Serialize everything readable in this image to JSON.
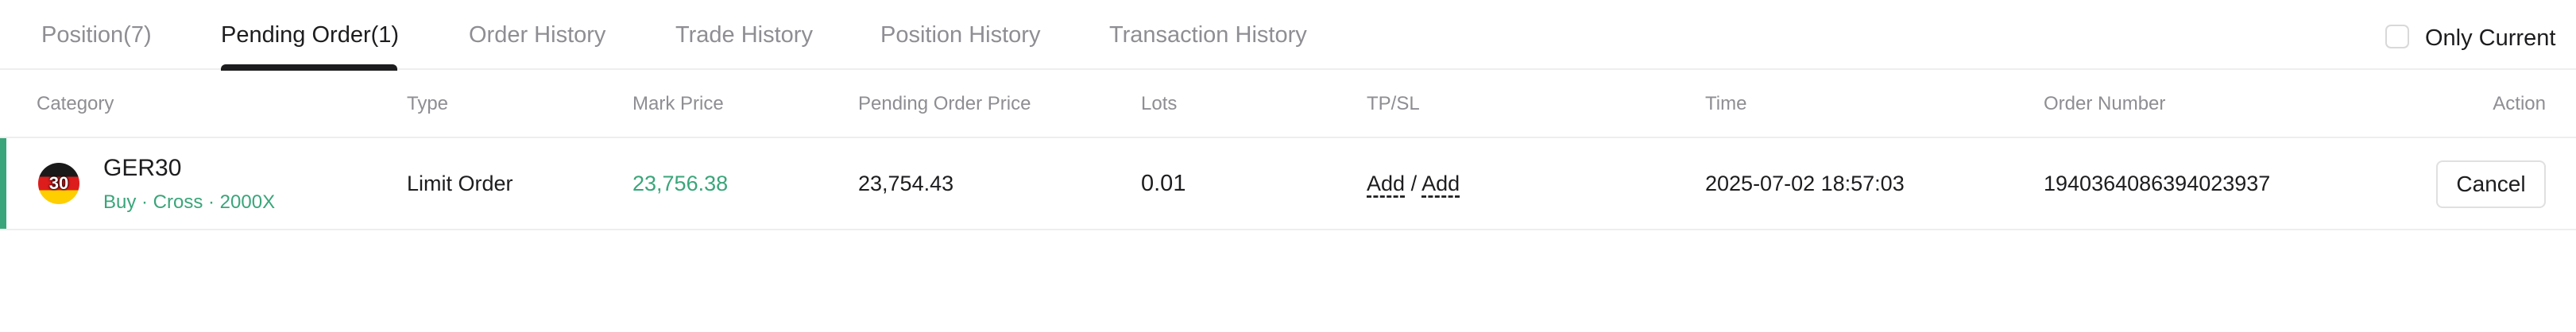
{
  "tabs": {
    "position": "Position(7)",
    "pending_order": "Pending Order(1)",
    "order_history": "Order History",
    "trade_history": "Trade History",
    "position_history": "Position History",
    "transaction_history": "Transaction History"
  },
  "only_current": {
    "label": "Only Current",
    "checked": false
  },
  "columns": {
    "category": "Category",
    "type": "Type",
    "mark_price": "Mark Price",
    "pending_order_price": "Pending Order Price",
    "lots": "Lots",
    "tp_sl": "TP/SL",
    "time": "Time",
    "order_number": "Order Number",
    "action": "Action"
  },
  "orders": [
    {
      "icon_text": "30",
      "icon_name": "germany-flag-icon",
      "symbol": "GER30",
      "meta": "Buy · Cross · 2000X",
      "type": "Limit Order",
      "mark_price": "23,756.38",
      "pending_order_price": "23,754.43",
      "lots": "0.01",
      "tp": "Add",
      "separator": "/",
      "sl": "Add",
      "time": "2025-07-02 18:57:03",
      "order_number": "1940364086394023937",
      "action": "Cancel"
    }
  ],
  "colors": {
    "accent_green": "#3aa57a",
    "active_tab_underline": "#1d1d1f",
    "muted_text": "#8e8e93",
    "divider": "#eeeeee"
  }
}
